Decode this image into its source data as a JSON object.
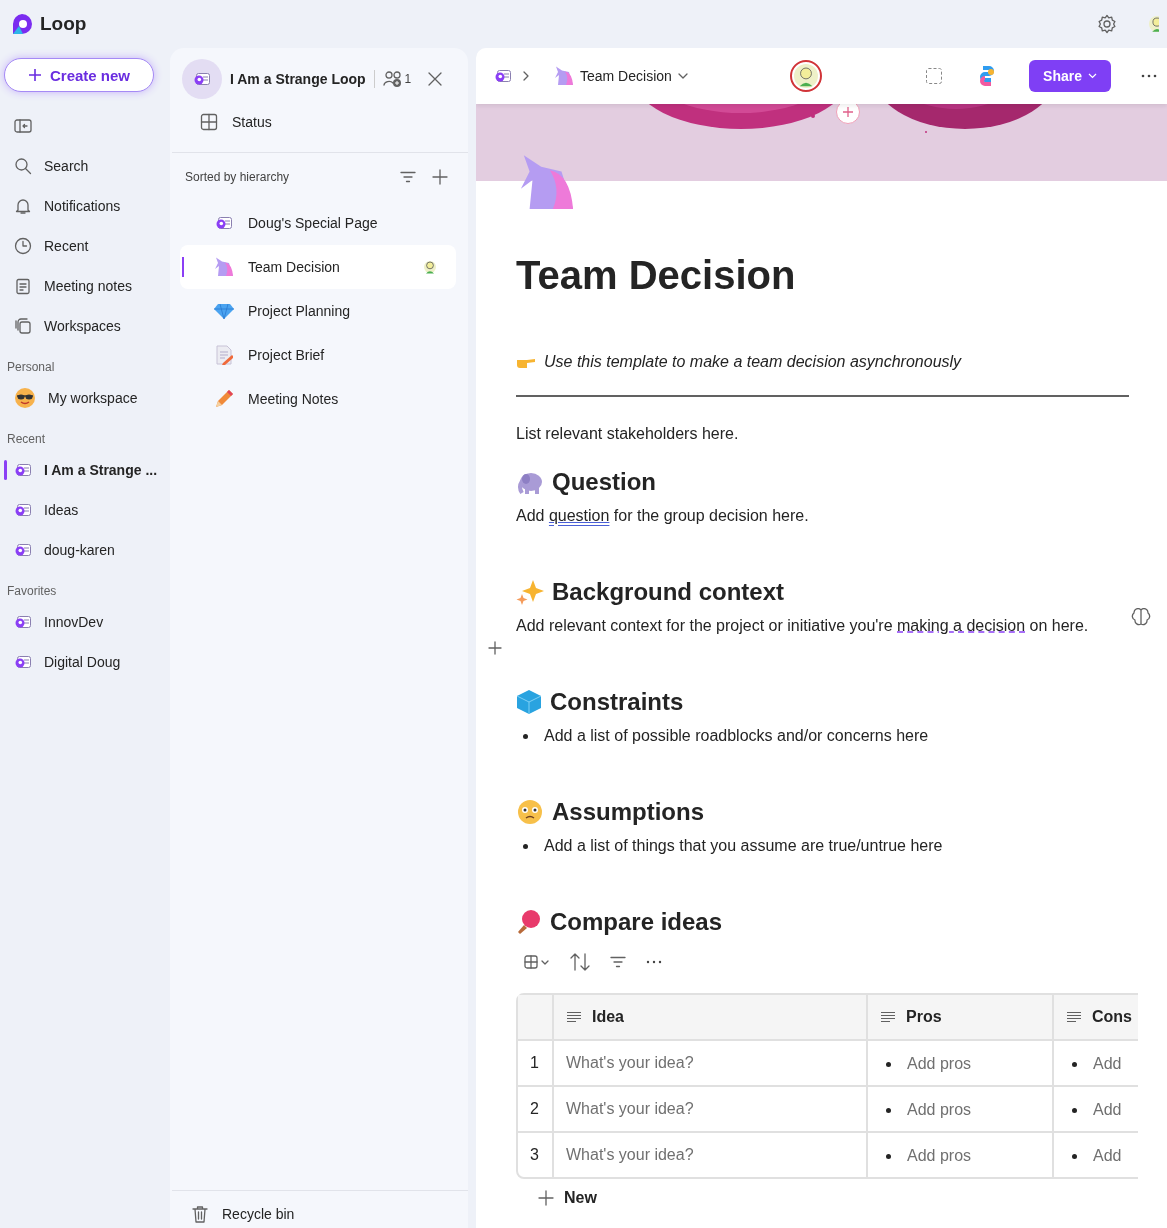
{
  "app": {
    "name": "Loop"
  },
  "nav": {
    "create_label": "Create new",
    "items": [
      {
        "label": "Search"
      },
      {
        "label": "Notifications"
      },
      {
        "label": "Recent"
      },
      {
        "label": "Meeting notes"
      },
      {
        "label": "Workspaces"
      }
    ],
    "sections": [
      {
        "title": "Personal",
        "items": [
          {
            "label": "My workspace",
            "selected": false
          }
        ]
      },
      {
        "title": "Recent",
        "items": [
          {
            "label": "I Am a Strange ...",
            "selected": true
          },
          {
            "label": "Ideas",
            "selected": false
          },
          {
            "label": "doug-karen",
            "selected": false
          }
        ]
      },
      {
        "title": "Favorites",
        "items": [
          {
            "label": "InnovDev",
            "selected": false
          },
          {
            "label": "Digital Doug",
            "selected": false
          }
        ]
      }
    ]
  },
  "workspace_panel": {
    "title": "I Am a Strange Loop",
    "member_count": "1",
    "status_label": "Status",
    "sort_label": "Sorted by hierarchy",
    "pages": [
      {
        "title": "Doug's Special Page",
        "selected": false,
        "avatar": false
      },
      {
        "title": "Team Decision",
        "selected": true,
        "avatar": true
      },
      {
        "title": "Project Planning",
        "selected": false,
        "avatar": false
      },
      {
        "title": "Project Brief",
        "selected": false,
        "avatar": false
      },
      {
        "title": "Meeting Notes",
        "selected": false,
        "avatar": false
      }
    ],
    "recycle_bin": "Recycle bin"
  },
  "document": {
    "breadcrumb": "Team Decision",
    "share_label": "Share",
    "title": "Team Decision",
    "callout": "Use this template to make a team decision asynchronously",
    "blocks": [
      {
        "kind": "paragraph",
        "segments": [
          {
            "text": "List relevant stakeholders here."
          }
        ]
      },
      {
        "kind": "heading",
        "text": "Question"
      },
      {
        "kind": "paragraph",
        "segments": [
          {
            "text": "Add "
          },
          {
            "text": "question",
            "kind": "grammar"
          },
          {
            "text": " for the group decision here."
          }
        ]
      },
      {
        "kind": "heading",
        "text": "Background context"
      },
      {
        "kind": "paragraph",
        "segments": [
          {
            "text": "Add relevant context for the project or initiative you're "
          },
          {
            "text": "making a decision",
            "kind": "spelling"
          },
          {
            "text": " on here."
          }
        ]
      },
      {
        "kind": "heading",
        "text": "Constraints"
      },
      {
        "kind": "bullet",
        "text": "Add a list of possible roadblocks and/or concerns here"
      },
      {
        "kind": "heading",
        "text": "Assumptions"
      },
      {
        "kind": "bullet",
        "text": "Add a list of things that you assume are true/untrue here"
      },
      {
        "kind": "heading",
        "text": "Compare ideas"
      }
    ],
    "table": {
      "columns": [
        "Idea",
        "Pros",
        "Cons"
      ],
      "rows": [
        {
          "number": "1",
          "idea": "What's your idea?",
          "pros": "Add pros",
          "cons": "Add"
        },
        {
          "number": "2",
          "idea": "What's your idea?",
          "pros": "Add pros",
          "cons": "Add"
        },
        {
          "number": "3",
          "idea": "What's your idea?",
          "pros": "Add pros",
          "cons": "Add"
        }
      ],
      "new_label": "New"
    }
  }
}
